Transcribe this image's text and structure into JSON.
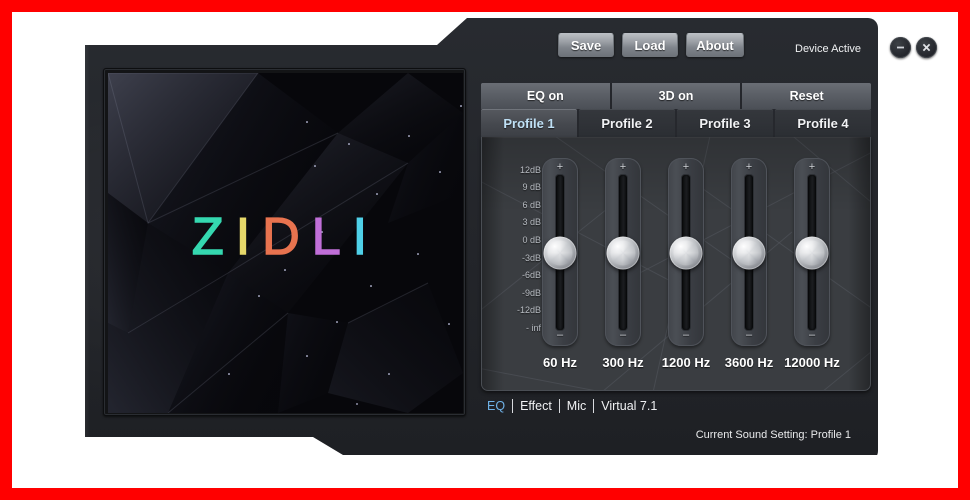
{
  "window": {
    "toolbar": {
      "save_label": "Save",
      "load_label": "Load",
      "about_label": "About",
      "device_status": "Device Active",
      "minimize_icon": "minimize-icon",
      "close_icon": "close-icon"
    },
    "modes": [
      {
        "label": "EQ on",
        "name": "eq-toggle"
      },
      {
        "label": "3D on",
        "name": "3d-toggle"
      },
      {
        "label": "Reset",
        "name": "reset"
      }
    ],
    "profiles": [
      {
        "label": "Profile 1",
        "active": true
      },
      {
        "label": "Profile 2",
        "active": false
      },
      {
        "label": "Profile 3",
        "active": false
      },
      {
        "label": "Profile 4",
        "active": false
      }
    ],
    "bottom_nav": [
      {
        "label": "EQ",
        "active": true
      },
      {
        "label": "Effect",
        "active": false
      },
      {
        "label": "Mic",
        "active": false
      },
      {
        "label": "Virtual 7.1",
        "active": false
      }
    ],
    "status_text": "Current Sound Setting: Profile 1"
  },
  "preview": {
    "logo_letters": [
      {
        "char": "Z",
        "color": "#35d8b0"
      },
      {
        "char": "I",
        "color": "#e6d86a"
      },
      {
        "char": "D",
        "color": "#e8734f"
      },
      {
        "char": "L",
        "color": "#c06fd8"
      },
      {
        "char": "I",
        "color": "#4fd0e8"
      }
    ]
  },
  "equalizer": {
    "db_labels": [
      "12dB",
      "9 dB",
      "6 dB",
      "3 dB",
      "0 dB",
      "-3dB",
      "-6dB",
      "-9dB",
      "-12dB",
      "- inf"
    ],
    "tick_color": "#4b8fd0",
    "bands": [
      {
        "freq_label": "60 Hz",
        "value_db": 0
      },
      {
        "freq_label": "300 Hz",
        "value_db": 0
      },
      {
        "freq_label": "1200 Hz",
        "value_db": 0
      },
      {
        "freq_label": "3600 Hz",
        "value_db": 0
      },
      {
        "freq_label": "12000 Hz",
        "value_db": 0
      }
    ],
    "plus_glyph": "+",
    "minus_glyph": "–",
    "range_db": [
      12,
      -12
    ]
  },
  "colors": {
    "accent_blue": "#6fb2e8",
    "frame_red": "#ff0000",
    "window_body": "#24262b",
    "panel_bg": "#3a3d41"
  }
}
